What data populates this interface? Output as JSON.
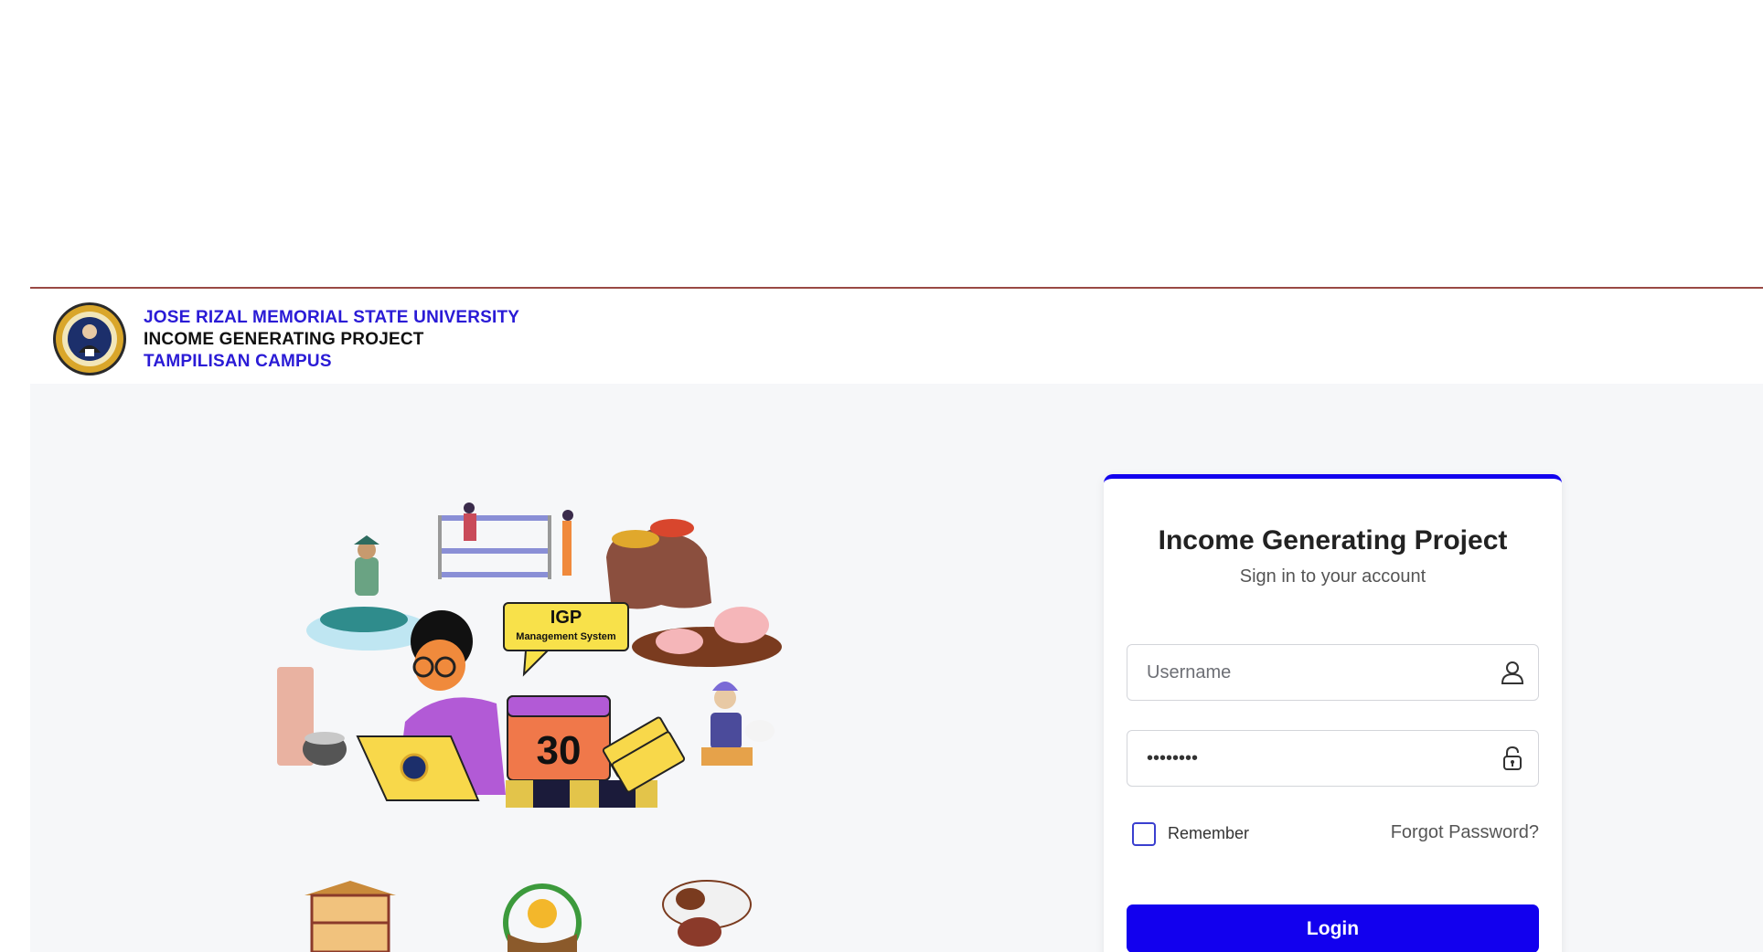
{
  "header": {
    "line1": "JOSE RIZAL MEMORIAL STATE UNIVERSITY",
    "line2": "INCOME GENERATING PROJECT",
    "line3": "TAMPILISAN CAMPUS",
    "logo_icon": "university-seal-icon"
  },
  "illustration": {
    "bubble_title": "IGP",
    "bubble_subtitle": "Management System",
    "calendar_day": "30"
  },
  "login": {
    "title": "Income Generating Project",
    "subtitle": "Sign in to your account",
    "username_placeholder": "Username",
    "password_value": "********",
    "remember_label": "Remember",
    "forgot_label": "Forgot Password?",
    "login_label": "Login",
    "user_icon": "user-icon",
    "lock_icon": "lock-icon"
  },
  "colors": {
    "accent": "#1200ee",
    "header_blue": "#2a1bd6",
    "rule": "#9b4a45"
  }
}
